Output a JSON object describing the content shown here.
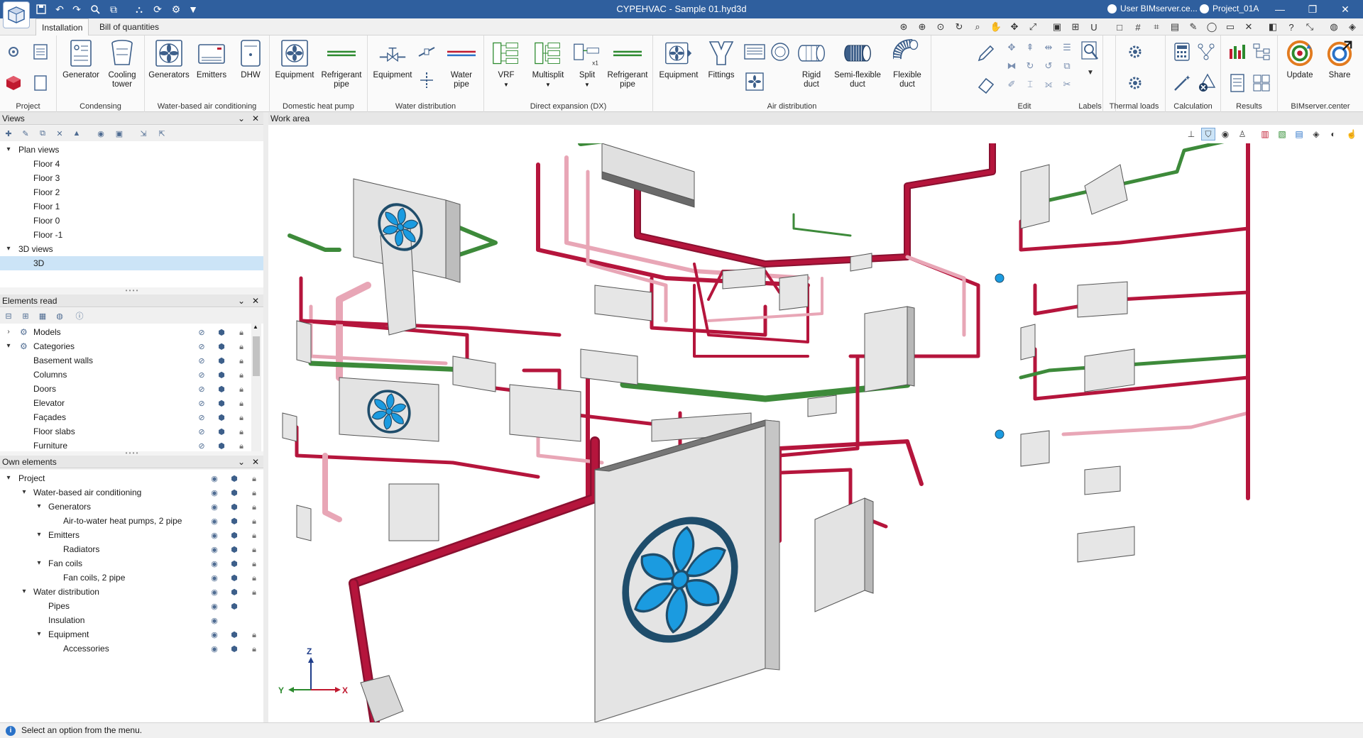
{
  "window": {
    "title": "CYPEHVAC - Sample 01.hyd3d",
    "user": "User BIMserver.ce...",
    "project": "Project_01A",
    "accent": "#2f5f9e"
  },
  "ribbon_tabs": [
    "Installation",
    "Bill of quantities"
  ],
  "ribbon": {
    "groups": {
      "project": "Project",
      "condensing": "Condensing",
      "water_air": "Water-based air conditioning",
      "domestic": "Domestic heat pump",
      "water_dist": "Water distribution",
      "dx": "Direct expansion (DX)",
      "air_dist": "Air distribution",
      "edit": "Edit",
      "labels": "Labels",
      "thermal": "Thermal loads",
      "calc": "Calculation",
      "results": "Results",
      "bim": "BIMserver.center"
    },
    "buttons": {
      "generator": "Generator",
      "cooling_tower_1": "Cooling",
      "cooling_tower_2": "tower",
      "generators": "Generators",
      "emitters": "Emitters",
      "dhw": "DHW",
      "equipment": "Equipment",
      "refrigerant_1": "Refrigerant",
      "refrigerant_2": "pipe",
      "water_pipe_1": "Water",
      "water_pipe_2": "pipe",
      "vrf": "VRF",
      "multisplit": "Multisplit",
      "split": "Split",
      "fittings": "Fittings",
      "rigid_1": "Rigid",
      "rigid_2": "duct",
      "semi_1": "Semi-flexible",
      "semi_2": "duct",
      "flex_1": "Flexible",
      "flex_2": "duct",
      "update": "Update",
      "share": "Share"
    }
  },
  "views_panel": {
    "title": "Views",
    "plan_views": "Plan views",
    "floors": [
      "Floor 4",
      "Floor 3",
      "Floor 2",
      "Floor 1",
      "Floor 0",
      "Floor -1"
    ],
    "views_3d": "3D views",
    "view_3d": "3D"
  },
  "elements_panel": {
    "title": "Elements read",
    "models": "Models",
    "categories": "Categories",
    "items": [
      "Basement walls",
      "Columns",
      "Doors",
      "Elevator",
      "Façades",
      "Floor slabs",
      "Furniture"
    ]
  },
  "own_panel": {
    "title": "Own elements",
    "project": "Project",
    "water_air": "Water-based air conditioning",
    "generators": "Generators",
    "heat_pumps": "Air-to-water heat pumps, 2 pipe",
    "emitters": "Emitters",
    "radiators": "Radiators",
    "fan_coils": "Fan coils",
    "fan_coils_2": "Fan coils, 2 pipe",
    "water_dist": "Water distribution",
    "pipes": "Pipes",
    "insulation": "Insulation",
    "equipment": "Equipment",
    "accessories": "Accessories"
  },
  "work_area": {
    "title": "Work area",
    "axes": {
      "z": "Z",
      "y": "Y",
      "x": "X"
    }
  },
  "colors": {
    "pipe_red": "#b5153c",
    "pipe_pink": "#e8a6b6",
    "pipe_green": "#3d8a3a",
    "fan_blue": "#1b9be0",
    "unit_gray": "#d9d9d9"
  },
  "status": {
    "message": "Select an option from the menu."
  }
}
